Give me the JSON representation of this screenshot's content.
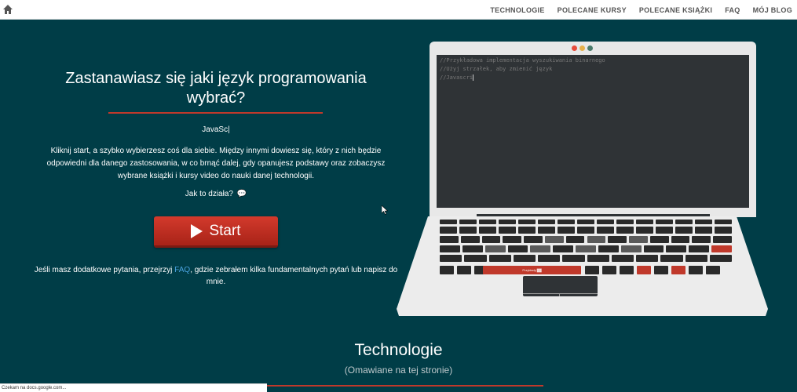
{
  "nav": {
    "home_icon": "home-icon",
    "links": [
      "TECHNOLOGIE",
      "POLECANE KURSY",
      "POLECANE KSIĄŻKI",
      "FAQ",
      "MÓJ BLOG"
    ]
  },
  "hero": {
    "title": "Zastanawiasz się jaki język programowania wybrać?",
    "typed_text": "JavaSc|",
    "description": "Kliknij start, a szybko wybierzesz coś dla siebie. Między innymi dowiesz się, który z nich będzie odpowiedni dla danego zastosowania, w co brnąć dalej, gdy opanujesz podstawy oraz zobaczysz wybrane książki i kursy video do nauki danej technologii.",
    "how_it_works": "Jak to działa?",
    "start_label": "Start",
    "extra_before": "Jeśli masz dodatkowe pytania, przejrzyj ",
    "extra_link": "FAQ",
    "extra_after": ", gdzie zebrałem kilka fundamentalnych pytań lub napisz do mnie."
  },
  "laptop": {
    "code_lines": [
      "//Przykładowa implementacja wyszukiwania binarnego",
      "//Użyj strzałek, aby zmienić język",
      "//Javascri"
    ],
    "spacebar_label": "Przykłady ▓▓",
    "dot_colors": [
      "#e74c3c",
      "#e6b04a",
      "#4a7a6a"
    ]
  },
  "section": {
    "title": "Technologie",
    "subtitle": "(Omawiane na tej stronie)"
  },
  "status_text": "Czekam na docs.google.com..."
}
